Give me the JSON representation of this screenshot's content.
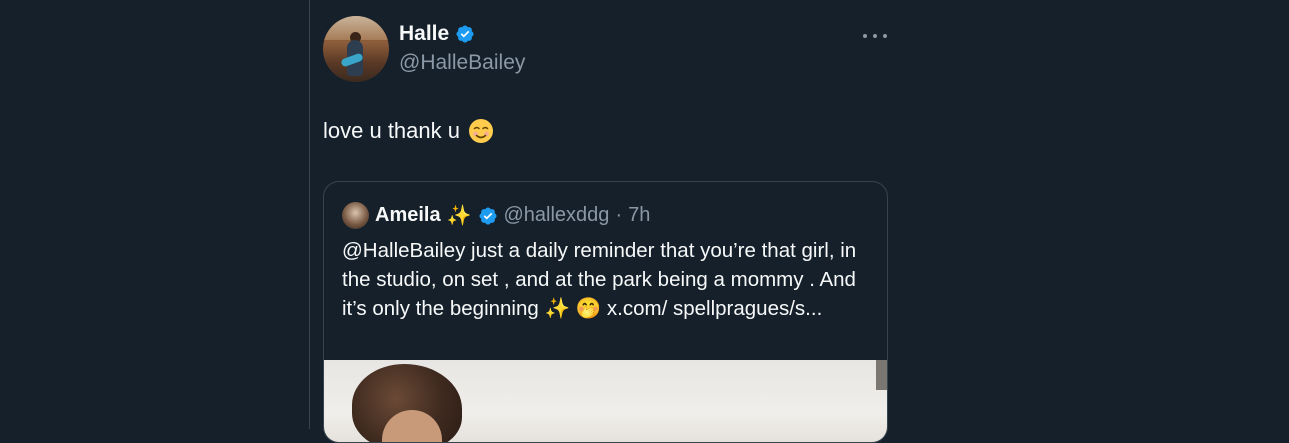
{
  "tweet": {
    "display_name": "Halle",
    "handle": "@HalleBailey",
    "text": "love u thank u",
    "emoji": "☺️"
  },
  "quote": {
    "display_name": "Ameila",
    "name_emoji": "✨",
    "handle": "@hallexddg",
    "separator": "·",
    "time": "7h",
    "body": "@HalleBailey just a daily reminder that you’re that girl, in the studio, on set , and at the park being a mommy . And it’s only the beginning ✨ 🤭 x.com/ spellpragues/s..."
  },
  "colors": {
    "background": "#15202b",
    "border": "#38444d",
    "text": "#f7f9f9",
    "muted": "#8b98a5",
    "verified": "#1d9bf0"
  },
  "icons": {
    "verified": "verified-badge-icon",
    "more": "more-options-icon"
  }
}
